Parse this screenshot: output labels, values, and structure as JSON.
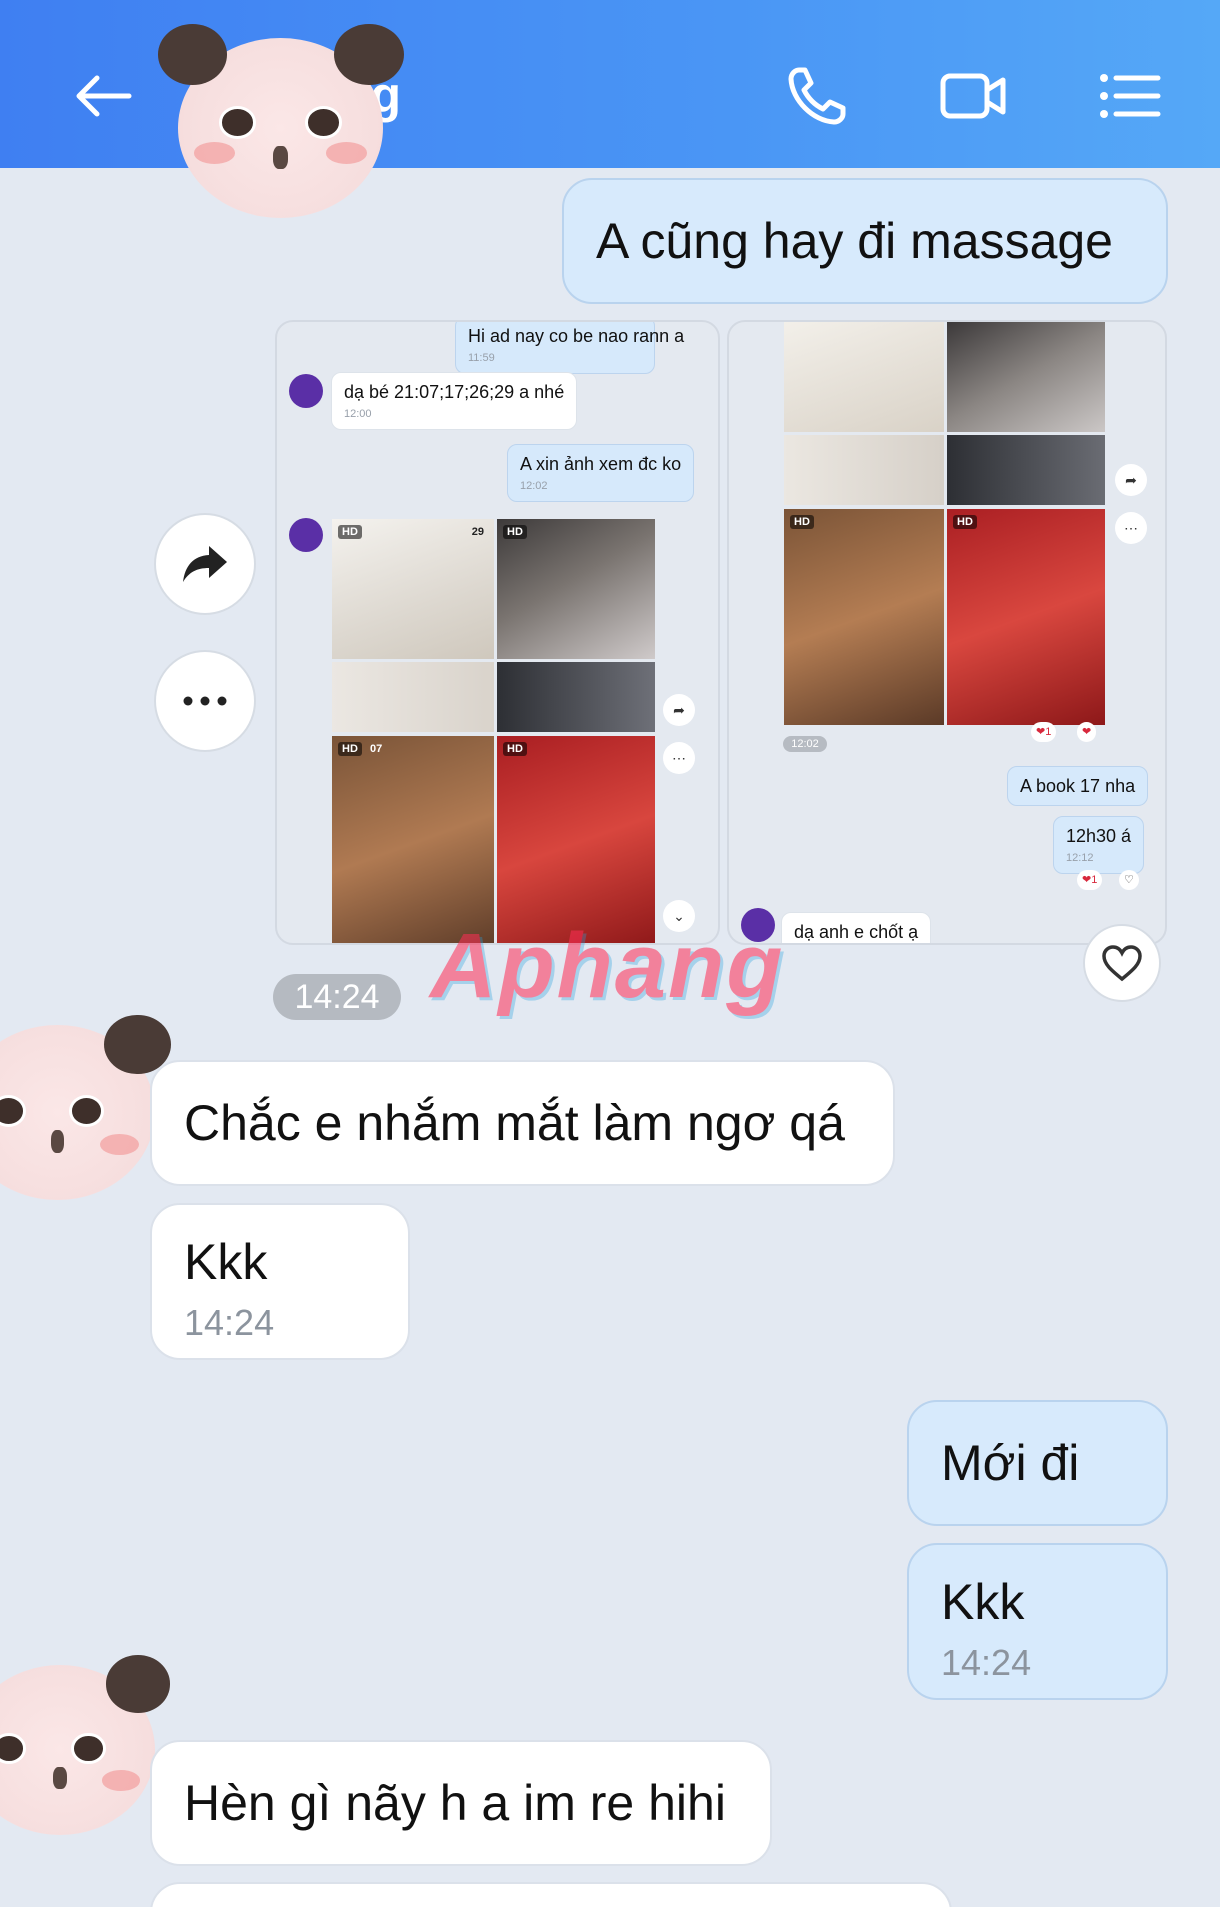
{
  "header": {
    "contact_name": "ng",
    "back_icon": "back-arrow-icon",
    "call_icon": "phone-icon",
    "video_icon": "video-camera-icon",
    "menu_icon": "list-menu-icon",
    "gradient_start": "#3f7ff2",
    "gradient_end": "#55a8f7"
  },
  "messages": {
    "m1": {
      "text": "A cũng hay đi massage"
    },
    "m_time_image": {
      "text": "14:24"
    },
    "m2": {
      "text": "Chắc e nhắm mắt làm ngơ qá"
    },
    "m3": {
      "text": "Kkk",
      "time": "14:24"
    },
    "m4": {
      "text": "Mới đi"
    },
    "m5": {
      "text": "Kkk",
      "time": "14:24"
    },
    "m6": {
      "text": "Hèn gì nãy h a im re hihi"
    }
  },
  "screenshot_left": {
    "top_cut": {
      "text": "Hi ad nay co be nao rann a",
      "time": "11:59"
    },
    "in1": {
      "text": "dạ bé 21:07;17;26;29 a nhé",
      "time": "12:00"
    },
    "out1": {
      "text": "A xin ảnh xem đc ko",
      "time": "12:02"
    },
    "badge_hd": "HD",
    "badge_num": "29",
    "badge_07": "07"
  },
  "screenshot_right": {
    "time_pill": "12:02",
    "out1": {
      "text": "A book 17 nha"
    },
    "out2": {
      "text": "12h30 á",
      "time": "12:12"
    },
    "in1": {
      "text": "dạ anh e chốt ạ"
    },
    "react_count": "1",
    "react_count2": "1",
    "badge_hd": "HD"
  },
  "watermark": "Aphang",
  "colors": {
    "outgoing_bubble": "#d7eafc",
    "incoming_bubble": "#ffffff",
    "background": "#e3e9f2"
  }
}
